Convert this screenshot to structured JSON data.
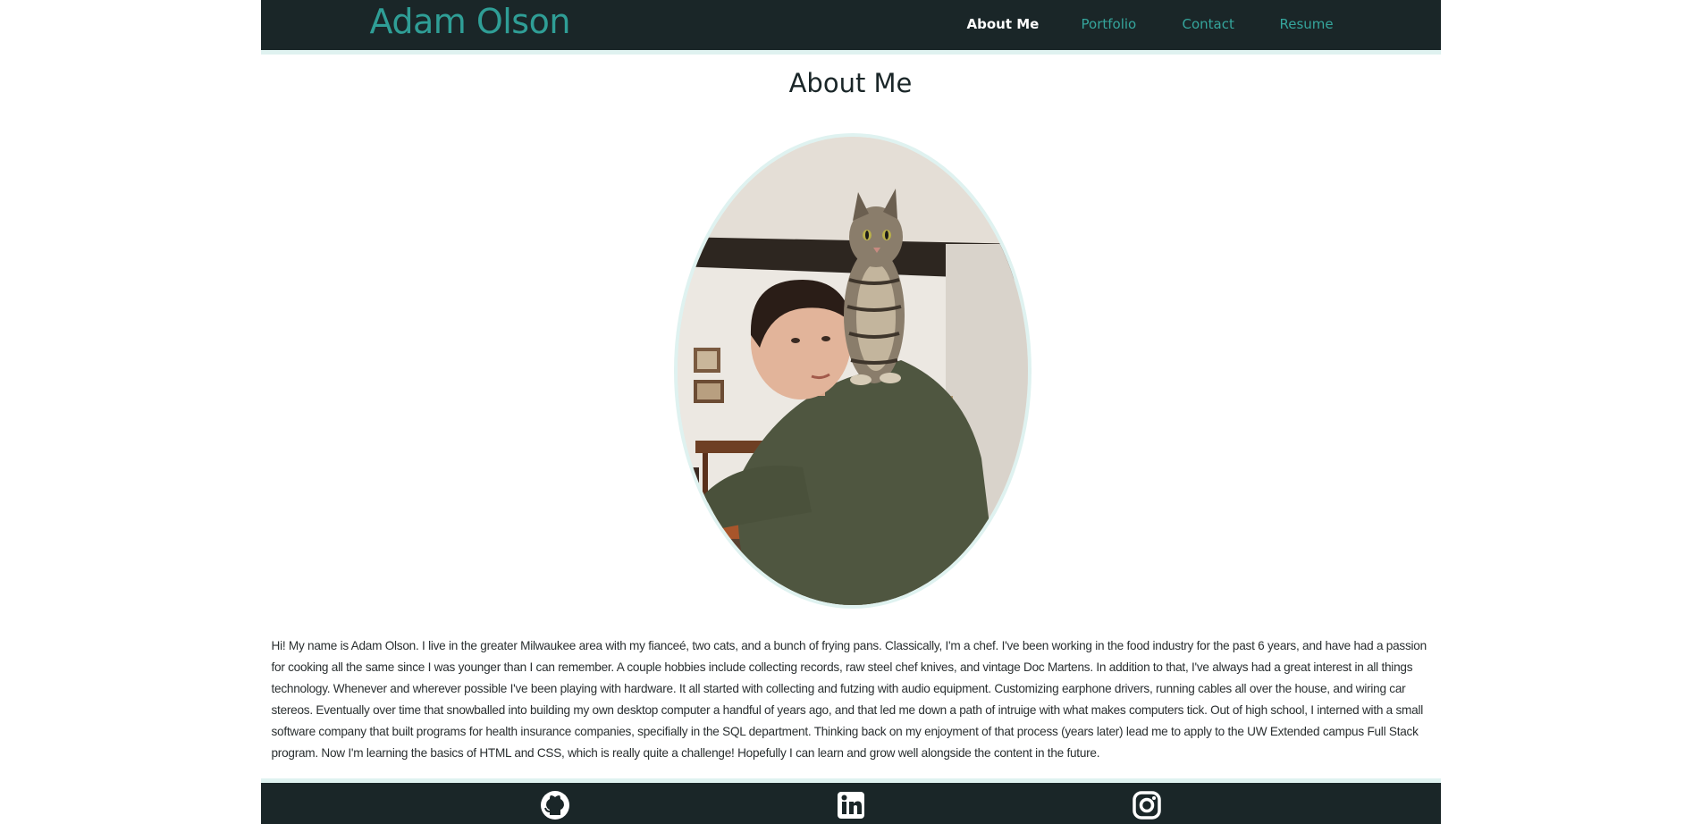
{
  "header": {
    "brand": "Adam Olson",
    "nav": [
      {
        "label": "About Me",
        "active": true
      },
      {
        "label": "Portfolio",
        "active": false
      },
      {
        "label": "Contact",
        "active": false
      },
      {
        "label": "Resume",
        "active": false
      }
    ]
  },
  "main": {
    "title": "About Me",
    "photo_icon": "profile-photo",
    "bio": "Hi! My name is Adam Olson. I live in the greater Milwaukee area with my fianceé, two cats, and a bunch of frying pans. Classically, I'm a chef. I've been working in the food industry for the past 6 years, and have had a passion for cooking all the same since I was younger than I can remember. A couple hobbies include collecting records, raw steel chef knives, and vintage Doc Martens. In addition to that, I've always had a great interest in all things technology. Whenever and wherever possible I've been playing with hardware. It all started with collecting and futzing with audio equipment. Customizing earphone drivers, running cables all over the house, and wiring car stereos. Eventually over time that snowballed into building my own desktop computer a handful of years ago, and that led me down a path of intruige with what makes computers tick. Out of high school, I interned with a small software company that built programs for health insurance companies, specifially in the SQL department. Thinking back on my enjoyment of that process (years later) lead me to apply to the UW Extended campus Full Stack program. Now I'm learning the basics of HTML and CSS, which is really quite a challenge! Hopefully I can learn and grow well alongside the content in the future."
  },
  "footer": {
    "icons": [
      "github-icon",
      "linkedin-icon",
      "instagram-icon"
    ]
  },
  "colors": {
    "dark": "#1a2628",
    "accent": "#2f9e96",
    "light_border": "#dff2f0"
  }
}
